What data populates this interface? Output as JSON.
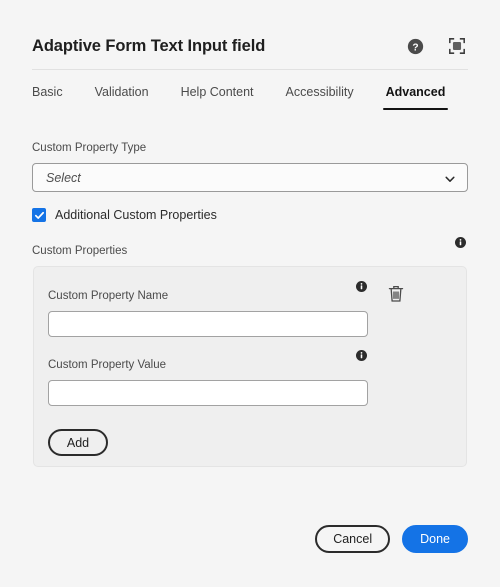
{
  "header": {
    "title": "Adaptive Form Text Input field",
    "help_icon": "help-circle-icon",
    "fullscreen_icon": "fullscreen-icon"
  },
  "tabs": [
    {
      "label": "Basic",
      "active": false
    },
    {
      "label": "Validation",
      "active": false
    },
    {
      "label": "Help Content",
      "active": false
    },
    {
      "label": "Accessibility",
      "active": false
    },
    {
      "label": "Advanced",
      "active": true
    }
  ],
  "custom_property_type": {
    "label": "Custom Property Type",
    "placeholder": "Select",
    "value": "Select",
    "chevron_icon": "chevron-down-icon"
  },
  "additional_custom_properties": {
    "label": "Additional Custom Properties",
    "checked": true
  },
  "custom_properties": {
    "label": "Custom Properties",
    "info_icon": "info-icon",
    "rows": [
      {
        "name_label": "Custom Property Name",
        "name_value": "",
        "name_placeholder": "",
        "value_label": "Custom Property Value",
        "value_value": "",
        "value_placeholder": "",
        "delete_icon": "trash-icon"
      }
    ],
    "add_label": "Add"
  },
  "footer": {
    "cancel_label": "Cancel",
    "done_label": "Done"
  },
  "colors": {
    "accent_blue": "#1473e6",
    "page_bg": "#f5f5f5",
    "card_bg": "#efefef",
    "text_primary": "#2c2c2c",
    "text_secondary": "#4b4b4b"
  }
}
